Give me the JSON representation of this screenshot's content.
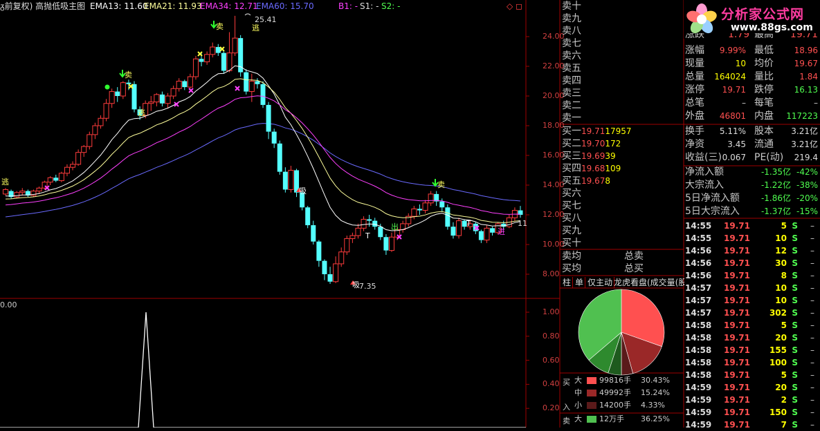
{
  "header": {
    "title": "ᵹ前复权) 高抛低吸主图",
    "ema13": "EMA13: 11.60",
    "ema21": "EMA21: 11.93",
    "ema34": "EMA34: 12.71",
    "ema60": "EMA60: 15.70",
    "b1": "B1: -",
    "s1": "S1: -",
    "s2": "S2: -",
    "corner_icons": "◇ ◻"
  },
  "colors": {
    "up": "#ff3c3c",
    "down": "#54ffff",
    "ema13": "#ffffff",
    "ema21": "#ffff9c",
    "ema34": "#ff40ff",
    "ema60": "#6a6aff",
    "grid": "#a00000",
    "buy": "#ff5050",
    "sell": "#50ff50"
  },
  "price_axis": {
    "ticks": [
      "24.00",
      "22.00",
      "20.00",
      "18.00",
      "16.00",
      "14.00",
      "12.00",
      "10.00",
      "8.00"
    ],
    "high_label": "25.41",
    "low_label": "7.35",
    "last_label": "11"
  },
  "indicator_axis": {
    "ticks": [
      "1.00",
      "0.80",
      "0.60",
      "0.40",
      "0.20"
    ],
    "top_label": "0.00"
  },
  "signals": {
    "sell_char": "卖",
    "escape_char": "逃",
    "buy_char": "吸",
    "out_char": "出",
    "in_char": "进",
    "t_char": "T"
  },
  "logo": {
    "title": "分析家公式网",
    "url": "www.88gs.com"
  },
  "orderbook": {
    "sells": [
      "卖十",
      "卖九",
      "卖八",
      "卖七",
      "卖六",
      "卖五",
      "卖四",
      "卖三",
      "卖二",
      "卖一"
    ],
    "buys": [
      {
        "label": "买一",
        "price": "19.71",
        "vol": "17957"
      },
      {
        "label": "买二",
        "price": "19.70",
        "vol": "172"
      },
      {
        "label": "买三",
        "price": "19.69",
        "vol": "39"
      },
      {
        "label": "买四",
        "price": "19.68",
        "vol": "109"
      },
      {
        "label": "买五",
        "price": "19.67",
        "vol": "8"
      },
      {
        "label": "买六",
        "price": "",
        "vol": ""
      },
      {
        "label": "买七",
        "price": "",
        "vol": ""
      },
      {
        "label": "买八",
        "price": "",
        "vol": ""
      },
      {
        "label": "买九",
        "price": "",
        "vol": ""
      },
      {
        "label": "买十",
        "price": "",
        "vol": ""
      }
    ],
    "sell_avg": "卖均",
    "total_sell": "总卖",
    "buy_avg": "买均",
    "total_buy": "总买"
  },
  "quote": {
    "partial_row": {
      "a": "涨跌",
      "b": "1.79",
      "c": "最高",
      "d": "19.71"
    },
    "rows": [
      {
        "a": "涨幅",
        "b": "9.99%",
        "c": "最低",
        "d": "18.96",
        "bc": "#ff5050",
        "dc": "#ff5050"
      },
      {
        "a": "现量",
        "b": "10",
        "c": "均价",
        "d": "19.67",
        "bc": "#ffff00",
        "dc": "#ff5050"
      },
      {
        "a": "总量",
        "b": "164024",
        "c": "量比",
        "d": "1.84",
        "bc": "#ffff00",
        "dc": "#ff5050"
      },
      {
        "a": "涨停",
        "b": "19.71",
        "c": "跌停",
        "d": "16.13",
        "bc": "#ff5050",
        "dc": "#50ff50"
      },
      {
        "a": "总笔",
        "b": "–",
        "c": "每笔",
        "d": "–",
        "bc": "#ccc",
        "dc": "#ccc"
      },
      {
        "a": "外盘",
        "b": "46801",
        "c": "内盘",
        "d": "117223",
        "bc": "#ff5050",
        "dc": "#50ff50"
      }
    ],
    "rows2": [
      {
        "a": "换手",
        "b": "5.11%",
        "c": "股本",
        "d": "3.21亿"
      },
      {
        "a": "净资",
        "b": "3.45",
        "c": "流通",
        "d": "3.21亿"
      },
      {
        "a": "收益(三)",
        "b": "0.067",
        "c": "PE(动)",
        "d": "219.4"
      }
    ],
    "flows": [
      {
        "label": "净流入额",
        "val": "-1.35亿",
        "pct": "-42%"
      },
      {
        "label": "大宗流入",
        "val": "-1.22亿",
        "pct": "-38%"
      },
      {
        "label": "5日净流入额",
        "val": "-1.86亿",
        "pct": "-20%"
      },
      {
        "label": "5日大宗流入",
        "val": "-1.37亿",
        "pct": "-15%"
      }
    ]
  },
  "ticks": [
    {
      "time": "14:55",
      "price": "19.71",
      "vol": "5",
      "side": "S",
      "dash": "–"
    },
    {
      "time": "14:55",
      "price": "19.71",
      "vol": "10",
      "side": "S",
      "dash": "–"
    },
    {
      "time": "14:56",
      "price": "19.71",
      "vol": "12",
      "side": "S",
      "dash": "–"
    },
    {
      "time": "14:56",
      "price": "19.71",
      "vol": "30",
      "side": "S",
      "dash": "–"
    },
    {
      "time": "14:56",
      "price": "19.71",
      "vol": "8",
      "side": "S",
      "dash": "–"
    },
    {
      "time": "14:57",
      "price": "19.71",
      "vol": "10",
      "side": "S",
      "dash": "–"
    },
    {
      "time": "14:57",
      "price": "19.71",
      "vol": "10",
      "side": "S",
      "dash": "–"
    },
    {
      "time": "14:57",
      "price": "19.71",
      "vol": "302",
      "side": "S",
      "dash": "–"
    },
    {
      "time": "14:58",
      "price": "19.71",
      "vol": "5",
      "side": "S",
      "dash": "–"
    },
    {
      "time": "14:58",
      "price": "19.71",
      "vol": "20",
      "side": "S",
      "dash": "–"
    },
    {
      "time": "14:58",
      "price": "19.71",
      "vol": "155",
      "side": "S",
      "dash": "–"
    },
    {
      "time": "14:58",
      "price": "19.71",
      "vol": "100",
      "side": "S",
      "dash": "–"
    },
    {
      "time": "14:58",
      "price": "19.71",
      "vol": "5",
      "side": "S",
      "dash": "–"
    },
    {
      "time": "14:59",
      "price": "19.71",
      "vol": "20",
      "side": "S",
      "dash": "–"
    },
    {
      "time": "14:59",
      "price": "19.71",
      "vol": "2",
      "side": "S",
      "dash": "–"
    },
    {
      "time": "14:59",
      "price": "19.71",
      "vol": "150",
      "side": "S",
      "dash": "–"
    },
    {
      "time": "14:59",
      "price": "19.71",
      "vol": "7",
      "side": "S",
      "dash": "–"
    }
  ],
  "tabs": [
    "柱",
    "单",
    "仅主动",
    "龙虎看盘(成交量(股"
  ],
  "pie": {
    "slices": [
      {
        "name": "买大",
        "pct": 30.43,
        "color": "#ff5050"
      },
      {
        "name": "买中",
        "pct": 15.24,
        "color": "#9a2828"
      },
      {
        "name": "买小",
        "pct": 4.33,
        "color": "#5a1a1a"
      },
      {
        "name": "卖小",
        "pct": 5.0,
        "color": "#1e5a1e"
      },
      {
        "name": "卖中",
        "pct": 8.75,
        "color": "#2e8a2e"
      },
      {
        "name": "卖大",
        "pct": 36.25,
        "color": "#50c050"
      }
    ]
  },
  "legend": {
    "buy_side": "买",
    "in_char": "入",
    "sell_side": "卖",
    "rows": [
      {
        "size": "大",
        "amount": "99816手",
        "pct": "30.43%",
        "color": "#ff5050"
      },
      {
        "size": "中",
        "amount": "49992手",
        "pct": "15.24%",
        "color": "#9a2828"
      },
      {
        "size": "小",
        "amount": "14200手",
        "pct": "4.33%",
        "color": "#5a1a1a"
      },
      {
        "size": "大",
        "amount": "12万手",
        "pct": "36.25%",
        "color": "#50c050"
      }
    ]
  },
  "chart_data": {
    "type": "candlestick",
    "ylim": [
      7,
      25.5
    ],
    "candles": [
      [
        13.4,
        13.7,
        13.3,
        13.8
      ],
      [
        13.6,
        13.2,
        13.1,
        13.7
      ],
      [
        13.2,
        13.5,
        13.1,
        13.6
      ],
      [
        13.5,
        13.6,
        13.3,
        13.8
      ],
      [
        13.6,
        13.3,
        13.2,
        13.7
      ],
      [
        13.3,
        13.6,
        13.2,
        13.7
      ],
      [
        13.6,
        13.8,
        13.4,
        13.9
      ],
      [
        13.8,
        14.2,
        13.7,
        14.3
      ],
      [
        14.2,
        14.5,
        14.0,
        14.6
      ],
      [
        14.5,
        14.3,
        14.2,
        14.7
      ],
      [
        14.3,
        14.8,
        14.2,
        14.9
      ],
      [
        14.8,
        15.2,
        14.6,
        15.4
      ],
      [
        15.2,
        15.4,
        15.0,
        15.6
      ],
      [
        15.4,
        16.2,
        15.3,
        16.4
      ],
      [
        16.2,
        16.6,
        15.9,
        16.7
      ],
      [
        16.6,
        17.4,
        16.4,
        17.6
      ],
      [
        17.4,
        18.0,
        17.1,
        18.2
      ],
      [
        18.0,
        18.5,
        17.8,
        18.7
      ],
      [
        18.5,
        19.5,
        18.3,
        19.8
      ],
      [
        19.5,
        20.3,
        19.2,
        20.5
      ],
      [
        20.3,
        20.0,
        19.6,
        20.6
      ],
      [
        20.0,
        20.9,
        19.8,
        21.0
      ],
      [
        20.9,
        20.8,
        20.4,
        21.1
      ],
      [
        20.8,
        19.1,
        18.9,
        21.0
      ],
      [
        19.1,
        18.7,
        18.4,
        19.3
      ],
      [
        18.7,
        19.5,
        18.5,
        19.7
      ],
      [
        19.5,
        19.6,
        19.0,
        20.0
      ],
      [
        19.6,
        20.1,
        19.3,
        20.2
      ],
      [
        20.1,
        19.5,
        19.3,
        20.3
      ],
      [
        19.5,
        20.0,
        19.2,
        20.2
      ],
      [
        20.0,
        20.5,
        19.8,
        20.7
      ],
      [
        20.5,
        21.0,
        20.3,
        21.2
      ],
      [
        21.0,
        20.6,
        20.4,
        21.1
      ],
      [
        20.6,
        21.3,
        20.5,
        21.5
      ],
      [
        21.3,
        22.5,
        21.1,
        22.7
      ],
      [
        22.5,
        22.3,
        22.0,
        22.9
      ],
      [
        22.3,
        22.8,
        22.1,
        23.0
      ],
      [
        22.8,
        23.3,
        22.6,
        23.6
      ],
      [
        23.3,
        22.9,
        22.7,
        23.5
      ],
      [
        22.9,
        21.7,
        21.5,
        23.1
      ],
      [
        21.7,
        22.9,
        21.6,
        24.3
      ],
      [
        22.9,
        23.9,
        22.7,
        25.4
      ],
      [
        23.9,
        21.6,
        21.3,
        24.1
      ],
      [
        21.6,
        20.3,
        20.1,
        21.8
      ],
      [
        20.3,
        21.0,
        19.6,
        21.5
      ],
      [
        21.0,
        20.8,
        20.5,
        21.2
      ],
      [
        20.8,
        19.4,
        19.2,
        21.0
      ],
      [
        19.4,
        17.6,
        17.1,
        19.6
      ],
      [
        17.6,
        16.8,
        16.5,
        17.8
      ],
      [
        16.8,
        14.9,
        14.7,
        17.0
      ],
      [
        14.9,
        13.7,
        13.5,
        15.2
      ],
      [
        13.7,
        15.0,
        13.5,
        15.3
      ],
      [
        15.0,
        13.5,
        13.2,
        15.1
      ],
      [
        13.5,
        12.5,
        12.3,
        13.6
      ],
      [
        12.5,
        11.3,
        11.1,
        12.6
      ],
      [
        11.3,
        10.2,
        10.0,
        11.6
      ],
      [
        10.2,
        8.9,
        8.5,
        10.3
      ],
      [
        8.9,
        8.0,
        7.6,
        9.0
      ],
      [
        8.0,
        7.5,
        7.35,
        8.5
      ],
      [
        7.5,
        8.7,
        7.4,
        9.2
      ],
      [
        8.7,
        9.5,
        8.5,
        9.8
      ],
      [
        9.5,
        10.4,
        9.3,
        10.6
      ],
      [
        10.4,
        10.6,
        10.1,
        10.8
      ],
      [
        10.6,
        11.1,
        10.4,
        11.4
      ],
      [
        11.1,
        11.7,
        10.9,
        11.9
      ],
      [
        11.7,
        11.6,
        11.2,
        12.0
      ],
      [
        11.6,
        11.2,
        11.0,
        11.8
      ],
      [
        11.2,
        10.5,
        10.3,
        11.4
      ],
      [
        10.5,
        9.6,
        9.3,
        10.7
      ],
      [
        9.6,
        10.5,
        9.5,
        10.8
      ],
      [
        10.5,
        11.0,
        10.3,
        11.2
      ],
      [
        11.0,
        11.4,
        10.8,
        11.6
      ],
      [
        11.4,
        11.9,
        11.2,
        12.1
      ],
      [
        11.9,
        12.4,
        11.7,
        12.6
      ],
      [
        12.4,
        12.3,
        12.0,
        12.7
      ],
      [
        12.3,
        12.8,
        12.1,
        13.0
      ],
      [
        12.8,
        13.4,
        12.6,
        13.6
      ],
      [
        13.4,
        12.9,
        12.6,
        13.6
      ],
      [
        12.9,
        12.5,
        12.2,
        13.1
      ],
      [
        12.5,
        11.2,
        11.0,
        12.7
      ],
      [
        11.2,
        10.6,
        10.4,
        11.5
      ],
      [
        10.6,
        11.6,
        10.4,
        11.8
      ],
      [
        11.6,
        11.2,
        11.0,
        11.7
      ],
      [
        11.2,
        11.4,
        11.0,
        11.6
      ],
      [
        11.4,
        10.9,
        10.7,
        11.5
      ],
      [
        10.9,
        10.3,
        10.1,
        11.0
      ],
      [
        10.3,
        11.1,
        10.1,
        11.3
      ],
      [
        11.1,
        10.8,
        10.6,
        11.2
      ],
      [
        10.8,
        11.4,
        10.7,
        11.5
      ],
      [
        11.4,
        11.2,
        11.0,
        11.6
      ],
      [
        11.2,
        11.8,
        11.1,
        12.0
      ],
      [
        11.8,
        12.3,
        11.6,
        12.5
      ],
      [
        12.3,
        12.0,
        11.8,
        12.6
      ]
    ]
  }
}
